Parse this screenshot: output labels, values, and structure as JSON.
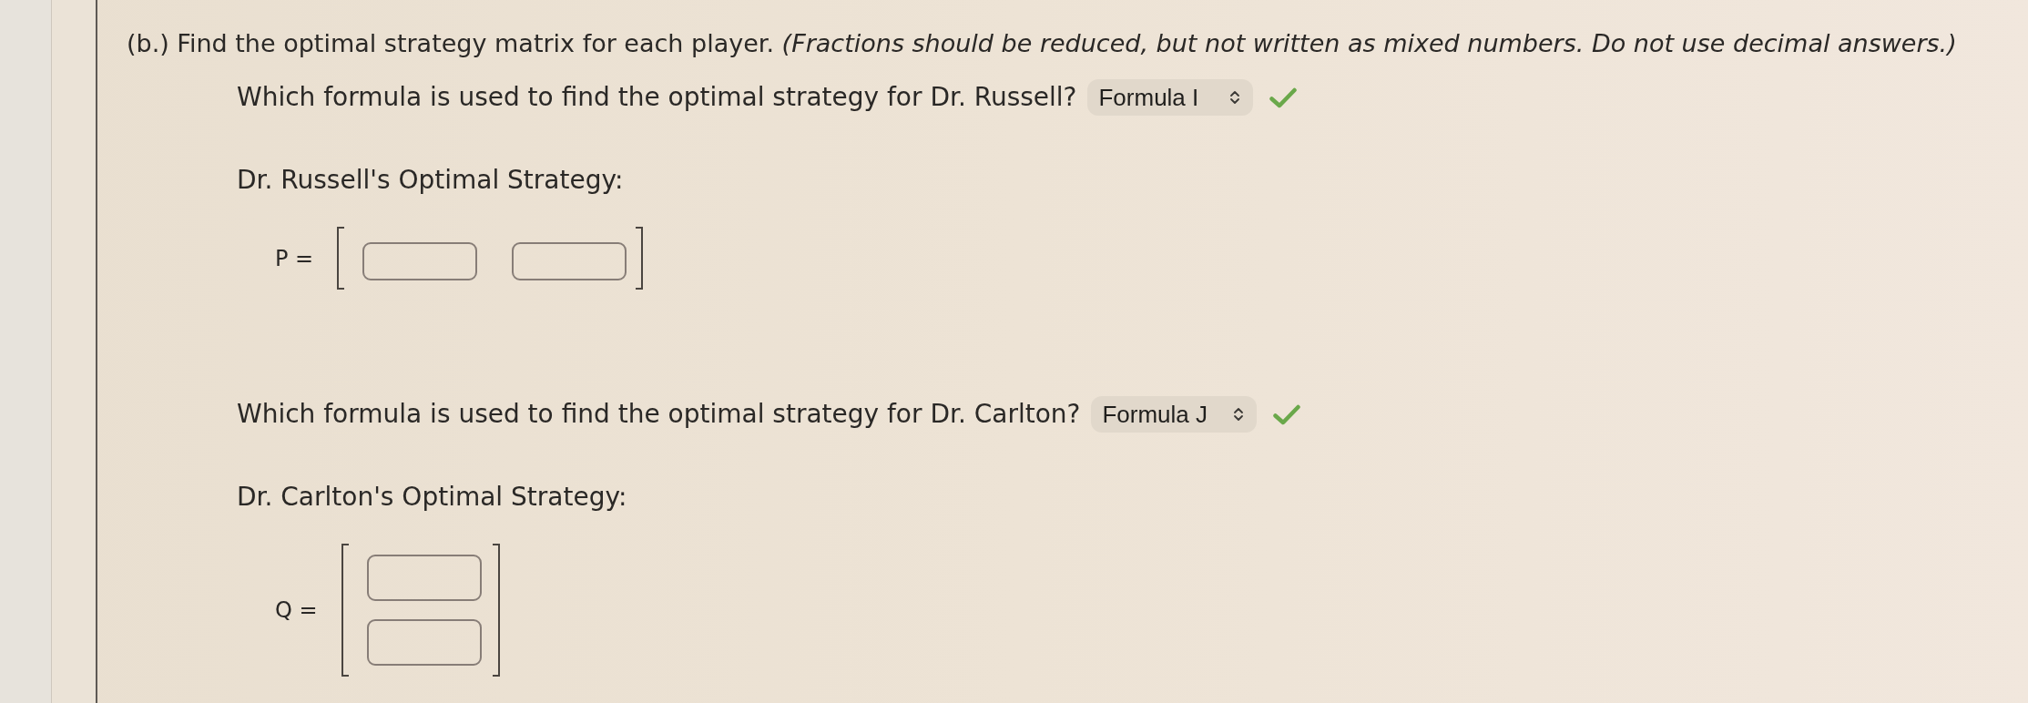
{
  "instruction": "(b.) Find the optimal strategy matrix for each player. *(Fractions should be reduced, but not written as mixed numbers. Do not use decimal answers.)*",
  "players": [
    {
      "question": "Which formula is used to find the optimal strategy for Dr. Russell?",
      "formula_select": {
        "value": "Formula I",
        "correct": true
      },
      "strategy_label": "Dr. Russell's Optimal Strategy:",
      "matrix": {
        "label": "P =",
        "kind": "row",
        "cells": [
          {
            "kind": "input"
          },
          {
            "kind": "input"
          }
        ]
      }
    },
    {
      "question": "Which formula is used to find the optimal strategy for Dr. Carlton?",
      "formula_select": {
        "value": "Formula J",
        "correct": true
      },
      "strategy_label": "Dr. Carlton's Optimal Strategy:",
      "matrix": {
        "label": "Q =",
        "kind": "column",
        "cells": [
          {
            "kind": "input"
          },
          {
            "kind": "input"
          }
        ]
      }
    }
  ]
}
